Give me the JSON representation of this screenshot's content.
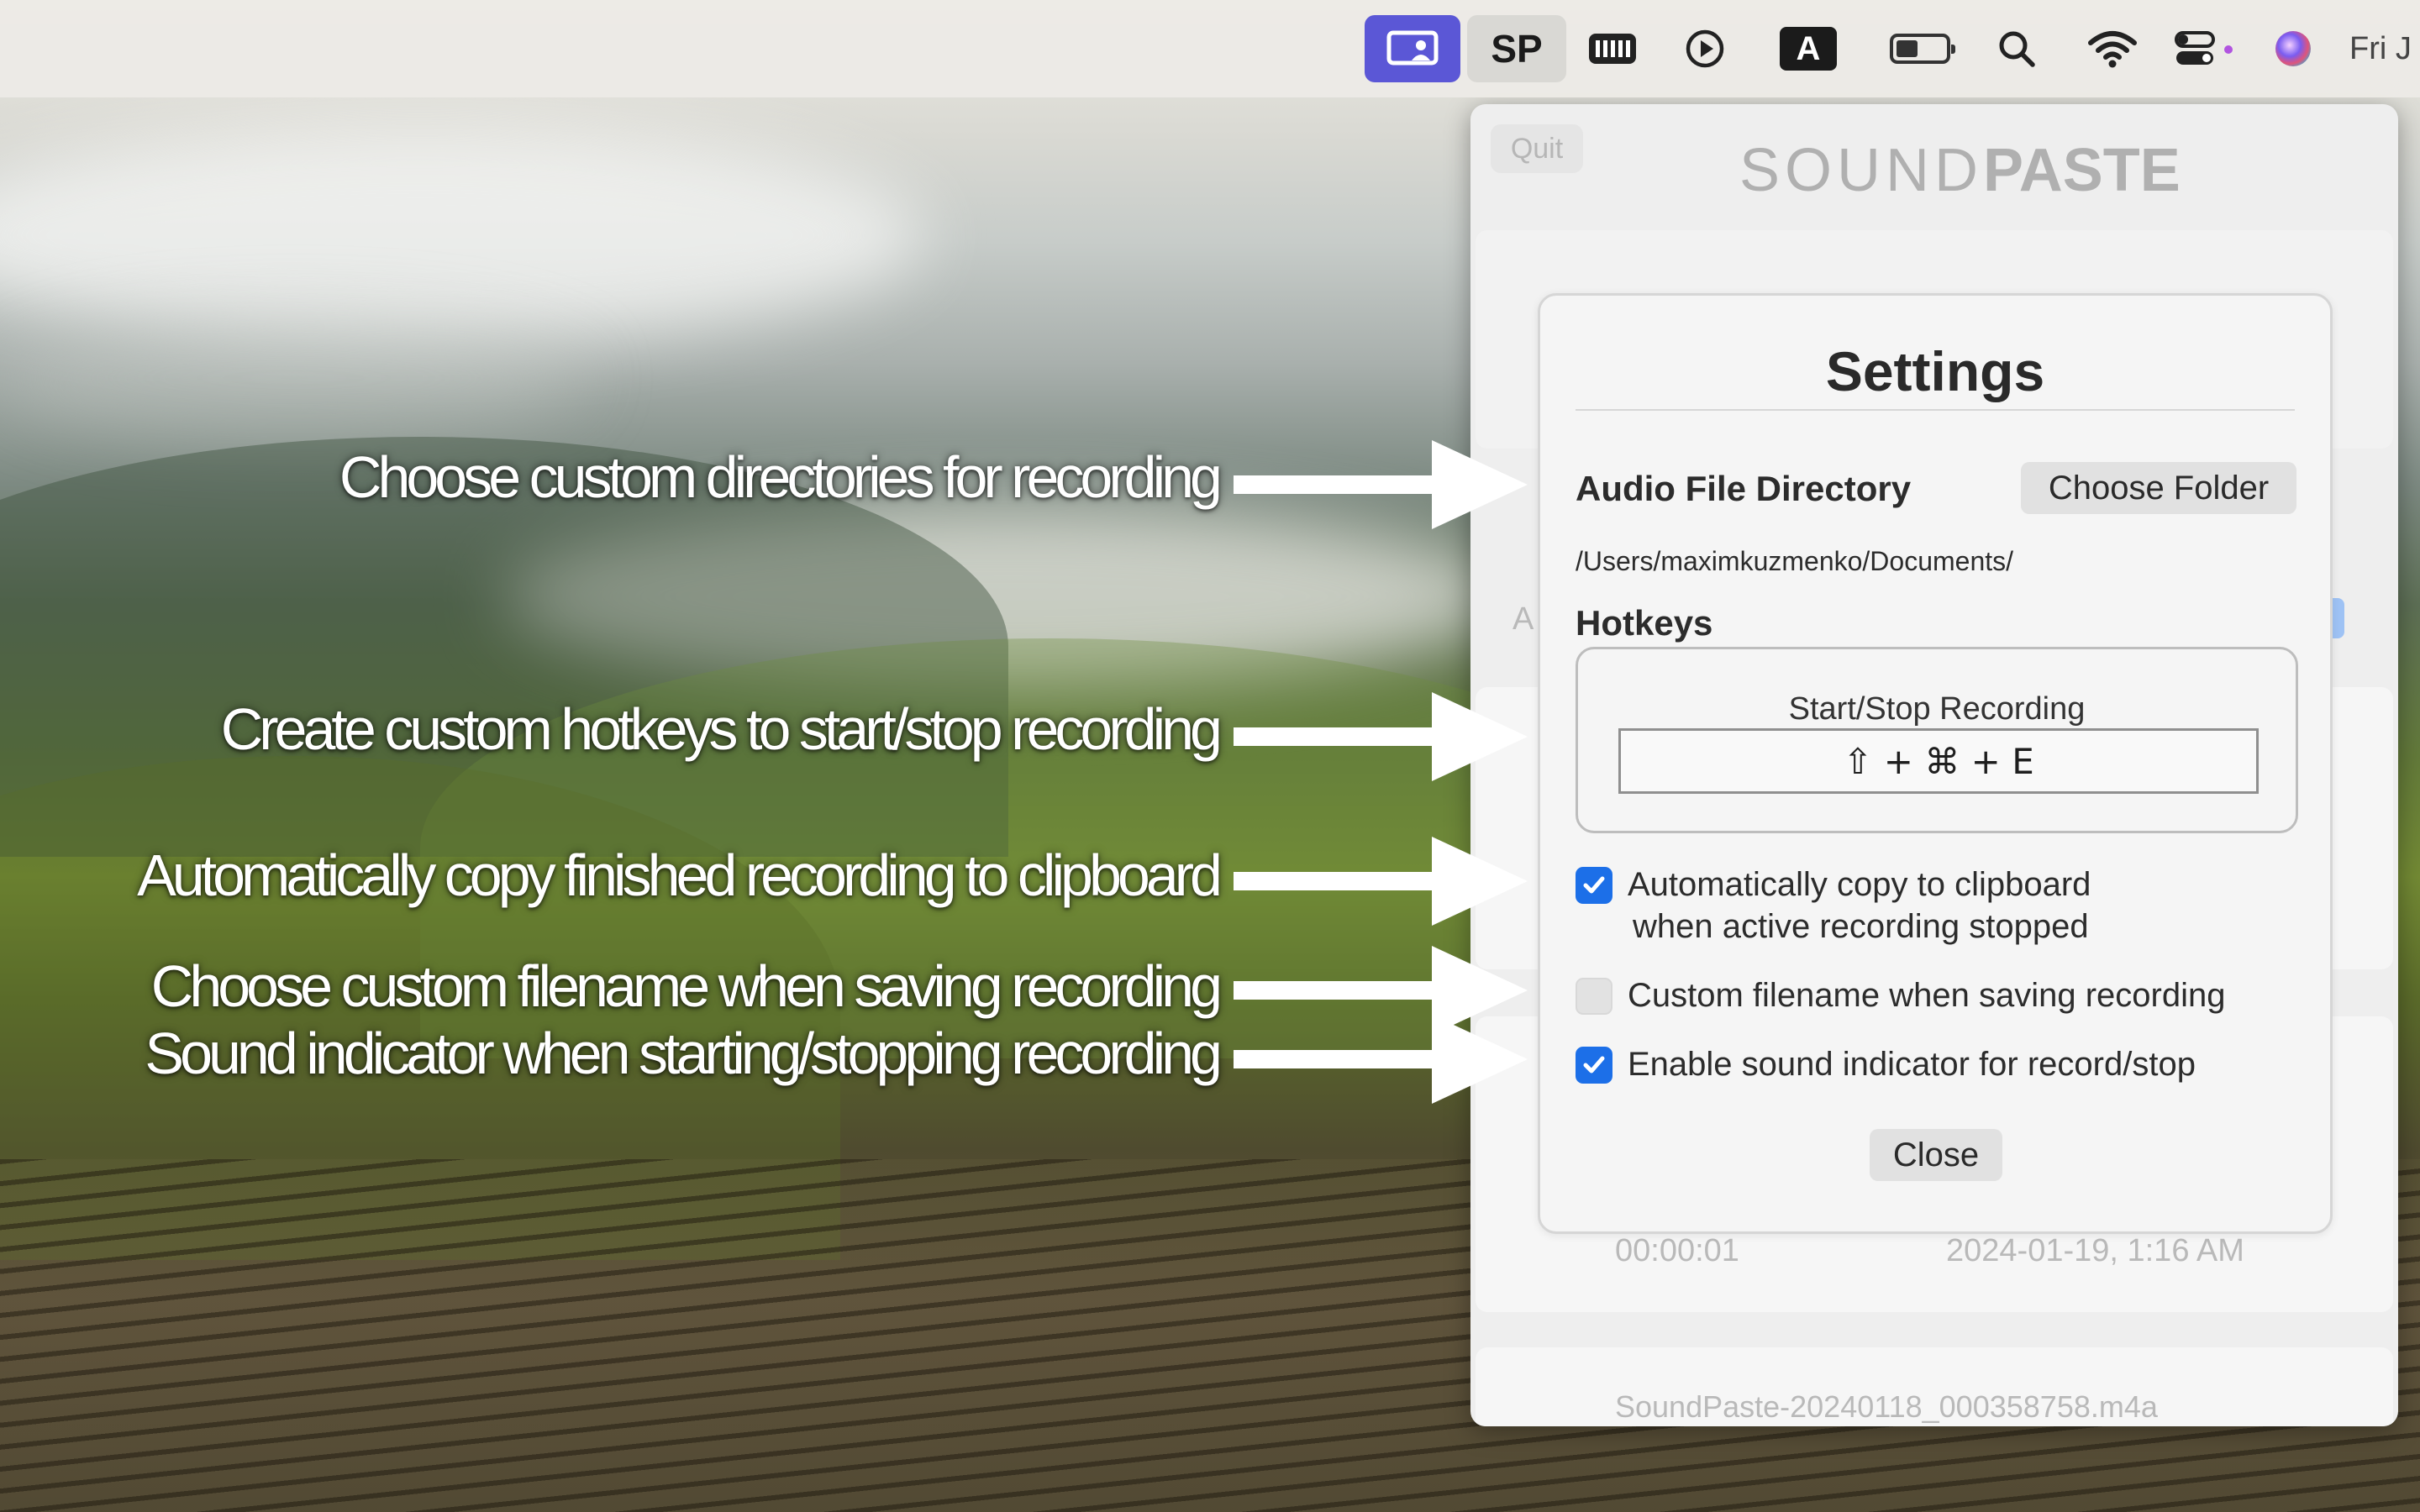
{
  "menubar": {
    "date_text": "Fri J",
    "battery_level": 0.45,
    "icons": [
      "screen-share-icon",
      "soundpaste-sp-icon",
      "keyboard-icon",
      "play-circle-icon",
      "text-input-a-icon",
      "battery-icon",
      "search-icon",
      "wifi-icon",
      "control-center-icon",
      "siri-icon"
    ],
    "sp_label": "SP",
    "input_label": "A"
  },
  "annotations": [
    {
      "text": "Choose custom directories for recording"
    },
    {
      "text": "Create custom hotkeys to start/stop recording"
    },
    {
      "text": "Automatically copy finished recording to clipboard"
    },
    {
      "text": "Choose custom filename when saving recording"
    },
    {
      "text": "Sound indicator when starting/stopping recording"
    }
  ],
  "app": {
    "quit_label": "Quit",
    "logo_light": "SOUND",
    "logo_bold": "PASTE",
    "left_partial": "A",
    "recording_duration": "00:00:01",
    "recording_date": "2024-01-19, 1:16 AM",
    "recording_filename": "SoundPaste-20240118_000358758.m4a"
  },
  "settings": {
    "title": "Settings",
    "audio_dir_label": "Audio File Directory",
    "choose_folder_label": "Choose Folder",
    "directory_path": "/Users/maximkuzmenko/Documents/",
    "hotkeys_label": "Hotkeys",
    "hotkey_action_label": "Start/Stop Recording",
    "hotkey_value": "⇧ + ⌘ + E",
    "option_copy_line1": "Automatically copy to clipboard",
    "option_copy_line2": "when active recording stopped",
    "option_copy_checked": true,
    "option_filename": "Custom filename when saving recording",
    "option_filename_checked": false,
    "option_sound": "Enable sound indicator for record/stop",
    "option_sound_checked": true,
    "close_label": "Close"
  },
  "colors": {
    "accent_blue": "#1c6fe8",
    "screen_share_purple": "#5b57d6",
    "record_red": "#eaa09a"
  }
}
